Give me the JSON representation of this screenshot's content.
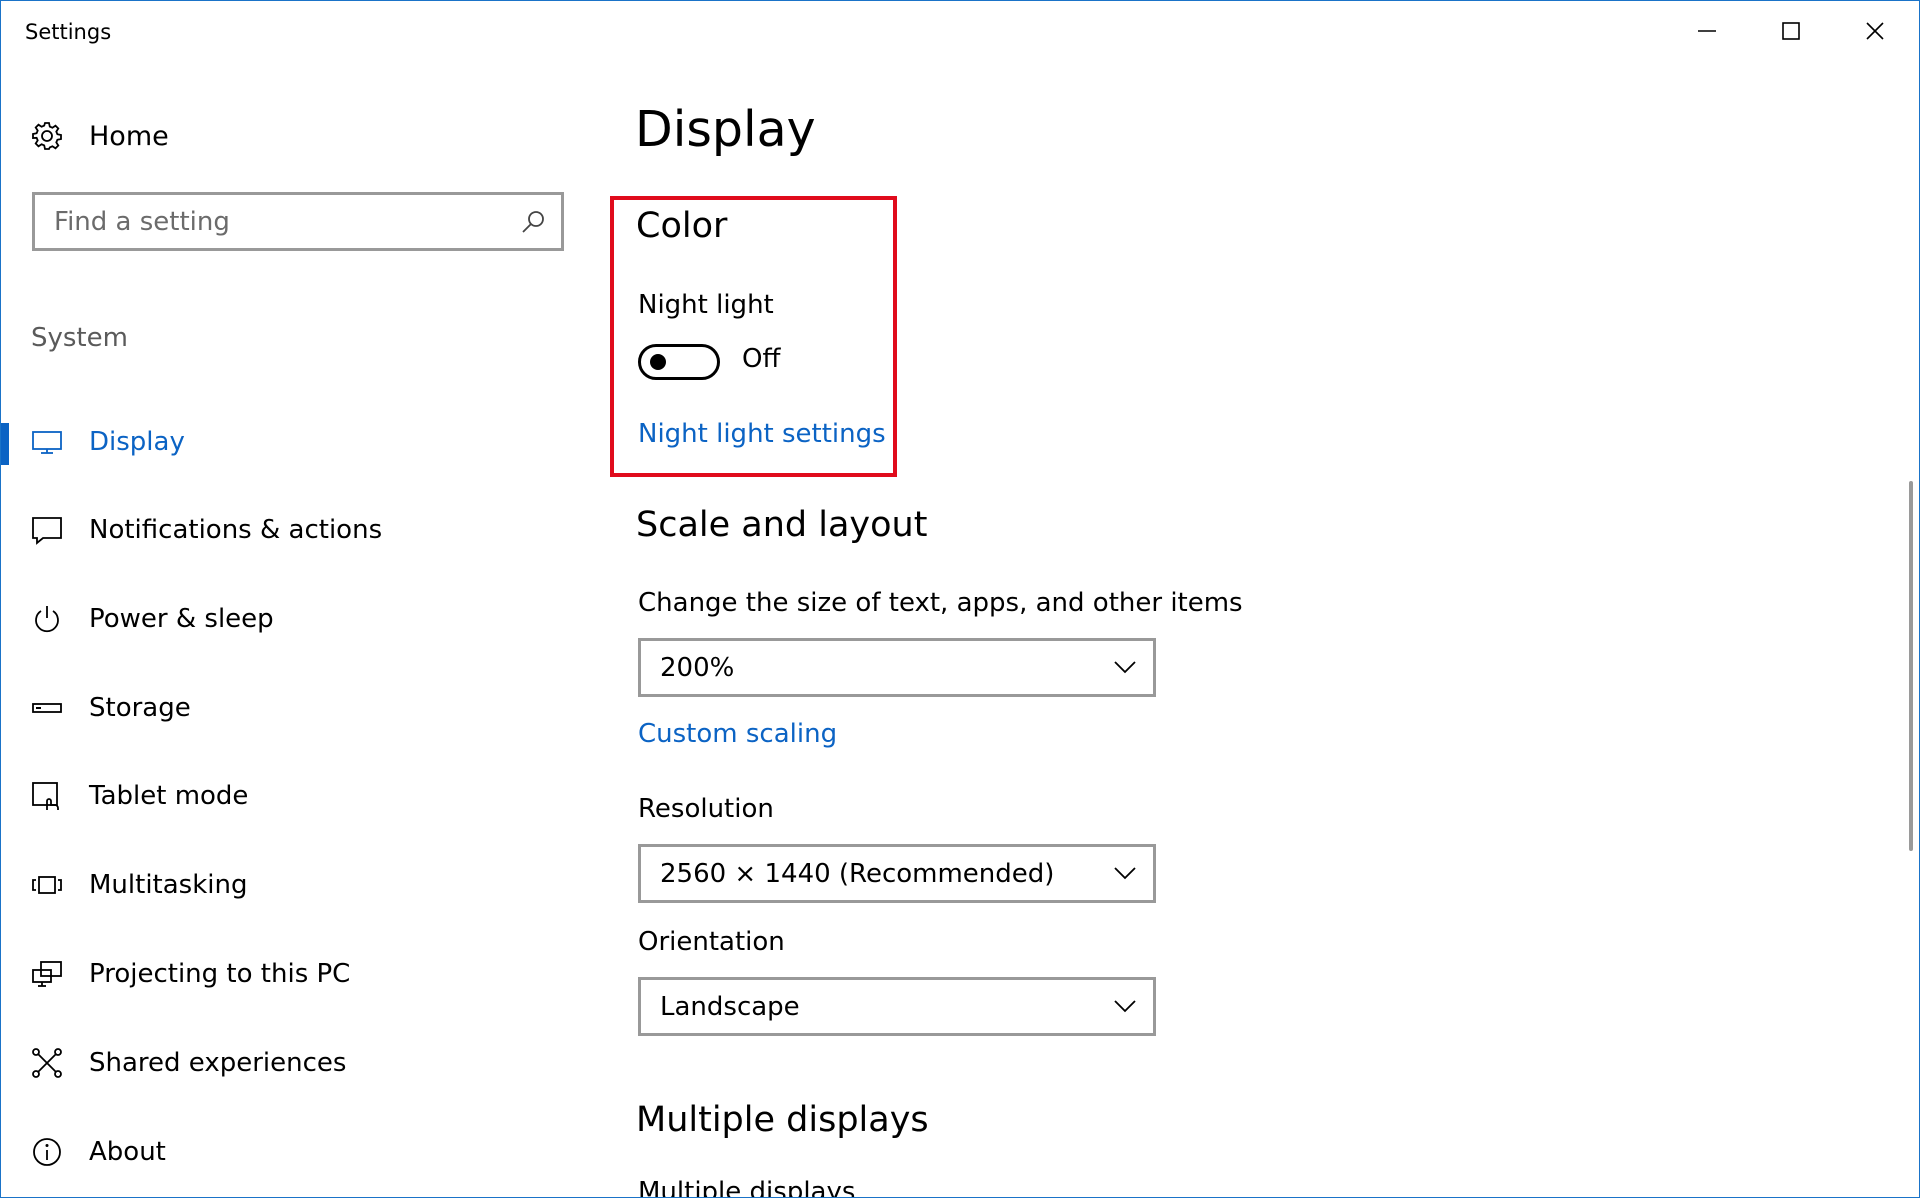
{
  "window": {
    "title": "Settings"
  },
  "sidebar": {
    "home_label": "Home",
    "search_placeholder": "Find a setting",
    "section_label": "System",
    "items": [
      {
        "label": "Display",
        "icon": "monitor-icon",
        "active": true
      },
      {
        "label": "Notifications & actions",
        "icon": "notification-icon"
      },
      {
        "label": "Power & sleep",
        "icon": "power-icon"
      },
      {
        "label": "Storage",
        "icon": "storage-icon"
      },
      {
        "label": "Tablet mode",
        "icon": "tablet-mode-icon"
      },
      {
        "label": "Multitasking",
        "icon": "multitasking-icon"
      },
      {
        "label": "Projecting to this PC",
        "icon": "projecting-icon"
      },
      {
        "label": "Shared experiences",
        "icon": "shared-experiences-icon"
      },
      {
        "label": "About",
        "icon": "info-icon"
      }
    ]
  },
  "main": {
    "page_title": "Display",
    "color": {
      "heading": "Color",
      "night_light_label": "Night light",
      "night_light_state": "Off",
      "night_light_settings_link": "Night light settings"
    },
    "scale": {
      "heading": "Scale and layout",
      "size_label": "Change the size of text, apps, and other items",
      "size_value": "200%",
      "custom_scaling_link": "Custom scaling",
      "resolution_label": "Resolution",
      "resolution_value": "2560 × 1440 (Recommended)",
      "orientation_label": "Orientation",
      "orientation_value": "Landscape"
    },
    "multiple_displays": {
      "heading": "Multiple displays",
      "sub_label": "Multiple displays"
    }
  },
  "colors": {
    "accent": "#0b63c4",
    "highlight": "#e00b1c",
    "window_border": "#1a73c8"
  }
}
